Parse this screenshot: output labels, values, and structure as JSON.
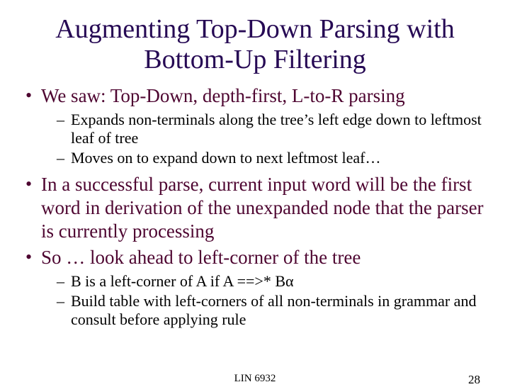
{
  "title": "Augmenting Top-Down Parsing with Bottom-Up Filtering",
  "bullets": {
    "b1": "We saw: Top-Down, depth-first, L-to-R parsing",
    "b1a": "Expands non-terminals along the tree’s left edge down to leftmost leaf of tree",
    "b1b": "Moves on to expand down to next leftmost leaf…",
    "b2": "In a successful parse, current input word will be the first word in derivation of the unexpanded node that the parser is currently processing",
    "b3": "So  …   look ahead to left-corner of the tree",
    "b3a": "B is a left-corner of A if  A ==>* Bα",
    "b3b": "Build table with left-corners of all non-terminals in grammar and consult before applying rule"
  },
  "footer": {
    "course": "LIN 6932",
    "page": "28"
  }
}
